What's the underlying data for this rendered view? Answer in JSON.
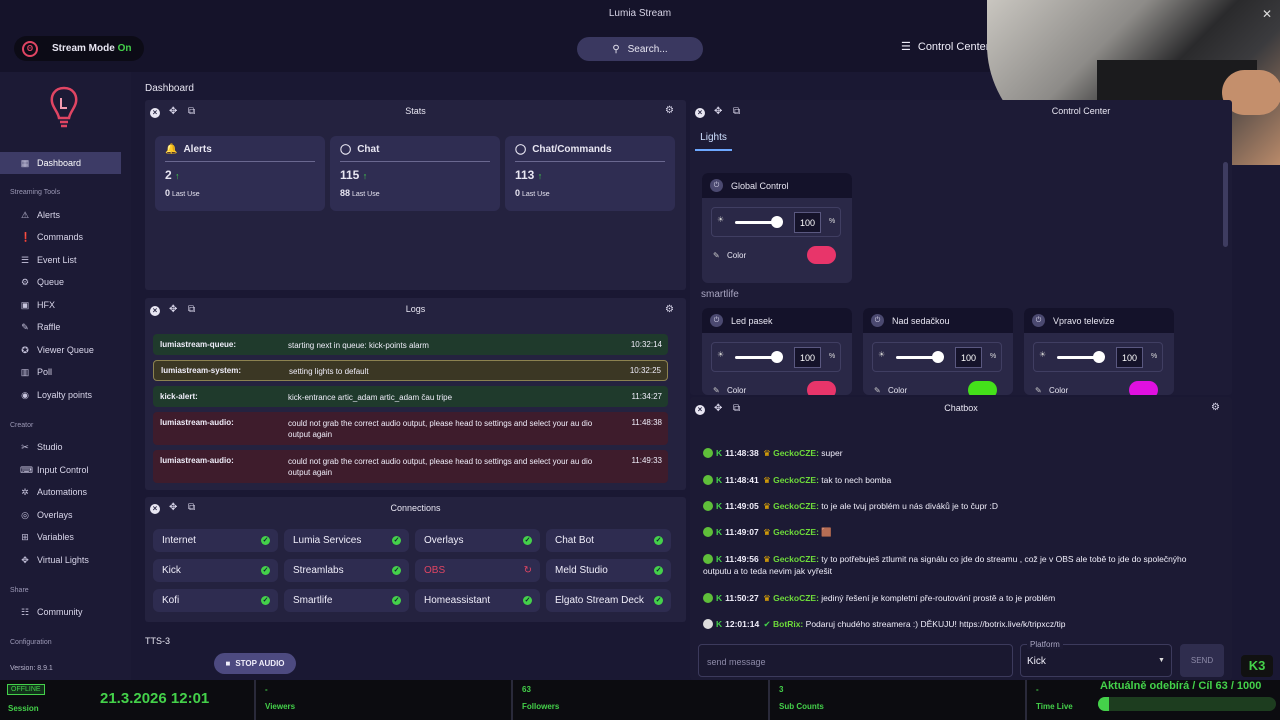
{
  "window": {
    "title": "Lumia Stream",
    "close": "✕"
  },
  "header": {
    "stream_mode_label": "Stream Mode",
    "stream_mode_state": "On",
    "search_label": "Search...",
    "control_center_label": "Control Center"
  },
  "sidebar": {
    "dashboard": "Dashboard",
    "streaming_tools_heading": "Streaming Tools",
    "streaming_tools": [
      "Alerts",
      "Commands",
      "Event List",
      "Queue",
      "HFX",
      "Raffle",
      "Viewer Queue",
      "Poll",
      "Loyalty points"
    ],
    "creator_heading": "Creator",
    "creator": [
      "Studio",
      "Input Control",
      "Automations",
      "Overlays",
      "Variables",
      "Virtual Lights"
    ],
    "share_heading": "Share",
    "share": [
      "Community"
    ],
    "configuration_heading": "Configuration",
    "version": "Version: 8.9.1"
  },
  "main": {
    "title": "Dashboard"
  },
  "stats": {
    "title": "Stats",
    "cards": [
      {
        "title": "Alerts",
        "value": "2",
        "last_value": "0",
        "last_label": "Last Use"
      },
      {
        "title": "Chat",
        "value": "115",
        "last_value": "88",
        "last_label": "Last Use"
      },
      {
        "title": "Chat/Commands",
        "value": "113",
        "last_value": "0",
        "last_label": "Last Use"
      }
    ]
  },
  "logs": {
    "title": "Logs",
    "rows": [
      {
        "source": "lumiastream-queue:",
        "message": "starting next in queue: kick-points alarm",
        "time": "10:32:14"
      },
      {
        "source": "lumiastream-system:",
        "message": "setting lights to default",
        "time": "10:32:25"
      },
      {
        "source": "kick-alert:",
        "message": "kick-entrance artic_adam artic_adam čau tripe",
        "time": "11:34:27"
      },
      {
        "source": "lumiastream-audio:",
        "message": "could not grab the correct audio output, please head to settings and select your au dio output again",
        "time": "11:48:38"
      },
      {
        "source": "lumiastream-audio:",
        "message": "could not grab the correct audio output, please head to settings and select your au dio output again",
        "time": "11:49:33"
      }
    ]
  },
  "connections": {
    "title": "Connections",
    "items": [
      "Internet",
      "Lumia Services",
      "Overlays",
      "Chat Bot",
      "Kick",
      "Streamlabs",
      "OBS",
      "Meld Studio",
      "Kofi",
      "Smartlife",
      "Homeassistant",
      "Elgato Stream Deck"
    ],
    "status": [
      "ok",
      "ok",
      "ok",
      "ok",
      "ok",
      "ok",
      "error",
      "ok",
      "ok",
      "ok",
      "ok",
      "ok"
    ]
  },
  "tts": {
    "label": "TTS-3",
    "stop_audio": "STOP AUDIO"
  },
  "control_center": {
    "title": "Control Center",
    "tab": "Lights",
    "group_label": "smartlife",
    "lights": [
      {
        "name": "Global Control",
        "brightness": "100",
        "pct": "%",
        "color_label": "Color",
        "color": "#e8356a"
      },
      {
        "name": "Led pasek",
        "brightness": "100",
        "pct": "%",
        "color_label": "Color",
        "color": "#e8356a"
      },
      {
        "name": "Nad sedačkou",
        "brightness": "100",
        "pct": "%",
        "color_label": "Color",
        "color": "#44e01a"
      },
      {
        "name": "Vpravo televize",
        "brightness": "100",
        "pct": "%",
        "color_label": "Color",
        "color": "#e010e0"
      }
    ]
  },
  "chatbox": {
    "title": "Chatbox",
    "messages": [
      {
        "time": "11:48:38",
        "user": "GeckoCZE:",
        "text": "super"
      },
      {
        "time": "11:48:41",
        "user": "GeckoCZE:",
        "text": "tak to nech bomba"
      },
      {
        "time": "11:49:05",
        "user": "GeckoCZE:",
        "text": "to je ale tvuj problém u nás diváků je to čupr :D"
      },
      {
        "time": "11:49:07",
        "user": "GeckoCZE:",
        "text": "🟫"
      },
      {
        "time": "11:49:56",
        "user": "GeckoCZE:",
        "text": "ty to potřebuješ ztlumit na signálu co jde do streamu , což je v OBS ale tobě to jde do společnýho outputu a to teda nevim jak vyřešit"
      },
      {
        "time": "11:50:27",
        "user": "GeckoCZE:",
        "text": "jediný řešení je kompletní pře-routování prostě a to je problém"
      },
      {
        "time": "12:01:14",
        "user": "BotRix:",
        "text": "Podaruj chudého streamera :) DĚKUJU! https://botrix.live/k/tripxcz/tip"
      }
    ],
    "input_placeholder": "send message",
    "platform_label": "Platform",
    "platform_value": "Kick",
    "send_label": "SEND"
  },
  "bottom": {
    "offline": "OFFLINE",
    "session": "Session",
    "date": "21.3.2026 12:01",
    "stats": [
      {
        "value": "-",
        "label": "Viewers"
      },
      {
        "value": "63",
        "label": "Followers"
      },
      {
        "value": "3",
        "label": "Sub Counts"
      },
      {
        "value": "-",
        "label": "Time Live"
      }
    ],
    "goal_text": "Aktuálně odebírá / Cíl  63 / 1000",
    "goal_fraction": 0.063
  },
  "kick_badge": "K3"
}
